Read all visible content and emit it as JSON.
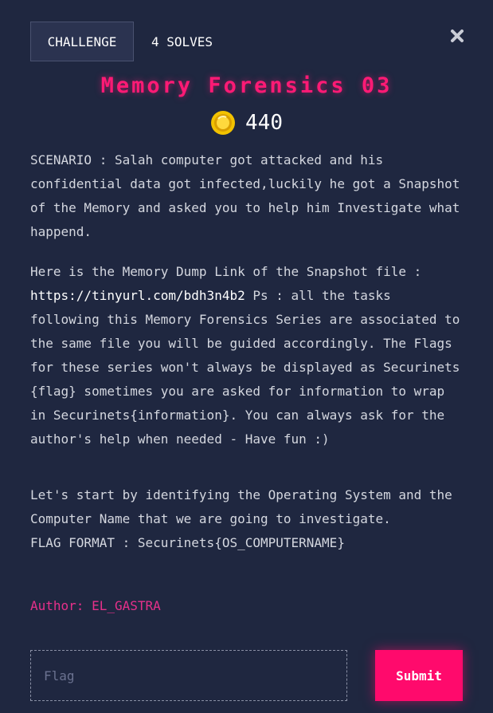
{
  "tabs": {
    "challenge_label": "CHALLENGE",
    "solves_label": "4 SOLVES"
  },
  "challenge": {
    "title": "Memory Forensics 03",
    "points": "440",
    "scenario_line": "SCENARIO : Salah computer got attacked and his confidential data got infected,luckily he got a Snapshot of the Memory and asked you to help him Investigate what happend.",
    "link_intro": "Here is the Memory Dump Link of the Snapshot file : ",
    "link_text": "https://tinyurl.com/bdh3n4b2",
    "link_after": " Ps : all the tasks following this Memory Forensics Series are associated to the same file you will be guided accordingly. The Flags for these series won't always be displayed as Securinets {flag} sometimes you are asked for information to wrap in Securinets{information}. You can always ask for the author's help when needed - Have fun :)",
    "task": "Let's start by identifying the Operating System and the Computer Name that we are going to investigate.",
    "flag_format": "FLAG FORMAT : Securinets{OS_COMPUTERNAME}",
    "author": "Author: EL_GASTRA"
  },
  "form": {
    "flag_placeholder": "Flag",
    "flag_value": "",
    "submit_label": "Submit"
  },
  "icons": {
    "close": "close-icon",
    "coin": "coin-icon"
  },
  "colors": {
    "background": "#1f2740",
    "accent": "#ff0a6c",
    "title": "#ff1a75",
    "author": "#e6308a",
    "coin": "#f2c200"
  }
}
